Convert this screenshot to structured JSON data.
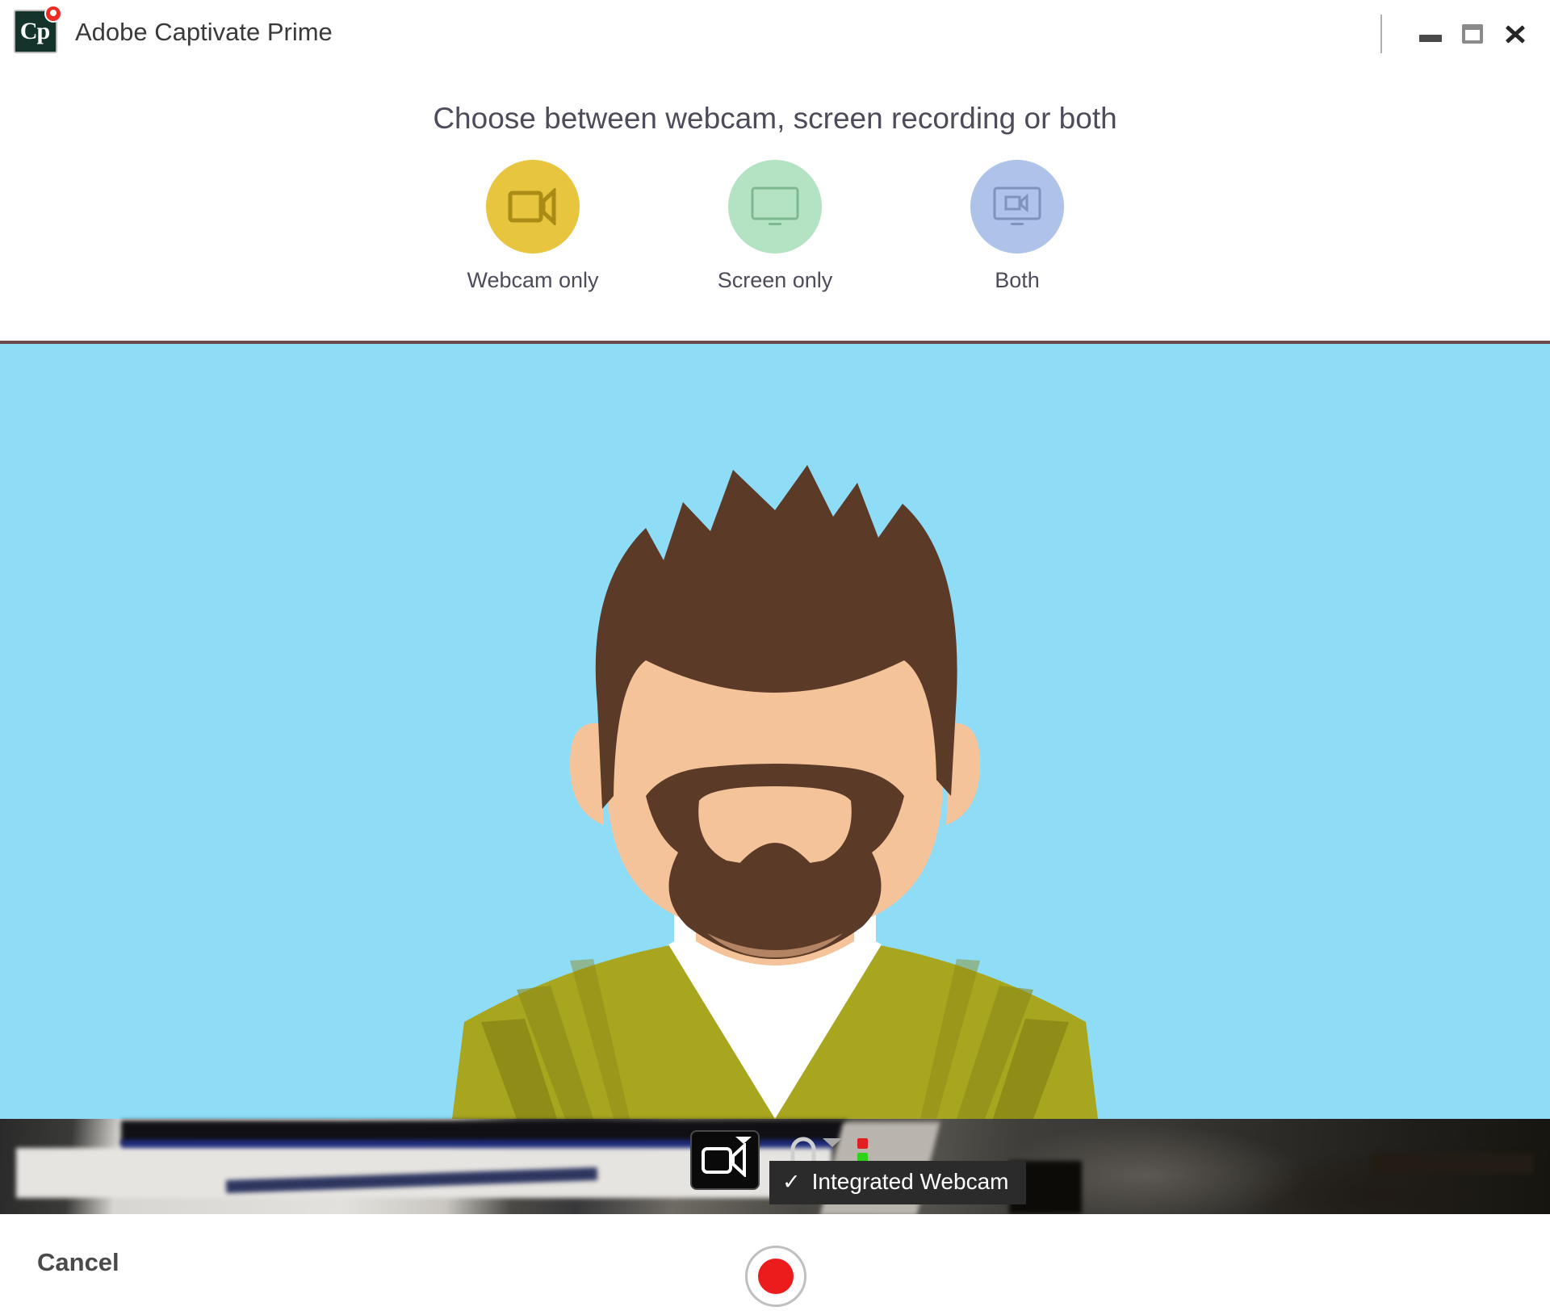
{
  "window": {
    "app_title": "Adobe Captivate Prime",
    "logo_text": "Cp",
    "controls": {
      "minimize": "minimize",
      "maximize": "maximize",
      "close": "close"
    }
  },
  "chooser": {
    "title": "Choose between webcam, screen recording or both",
    "modes": [
      {
        "label": "Webcam only",
        "icon": "video-camera-icon",
        "circle_color": "#e8c53f",
        "icon_color": "#a98b16"
      },
      {
        "label": "Screen only",
        "icon": "monitor-icon",
        "circle_color": "#b4e3c3",
        "icon_color": "#7eb890"
      },
      {
        "label": "Both",
        "icon": "monitor-with-camera-icon",
        "circle_color": "#aec2ea",
        "icon_color": "#7f93bd"
      }
    ]
  },
  "preview": {
    "background_color": "#8fdcf7",
    "avatar": {
      "hair_color": "#5b3a27",
      "skin_color": "#f5c39a",
      "skin_shadow_color": "#d9a47e",
      "beard_color": "#5b3a27",
      "shirt_color": "#a8a51e",
      "shirt_shadow_color": "#8b8818",
      "undershirt_color": "#ffffff"
    }
  },
  "camera_bar": {
    "camera_button_icon": "video-camera-icon",
    "camera_caret_icon": "caret-down-icon",
    "mic_icon": "headset-icon",
    "mic_caret_icon": "caret-down-icon",
    "led_red_color": "#e02020",
    "led_green_color": "#2fd11a",
    "dropdown": {
      "check_glyph": "✓",
      "item_label": "Integrated Webcam"
    }
  },
  "footer": {
    "cancel_label": "Cancel",
    "record_label": "record",
    "record_color": "#ec1c1c"
  }
}
